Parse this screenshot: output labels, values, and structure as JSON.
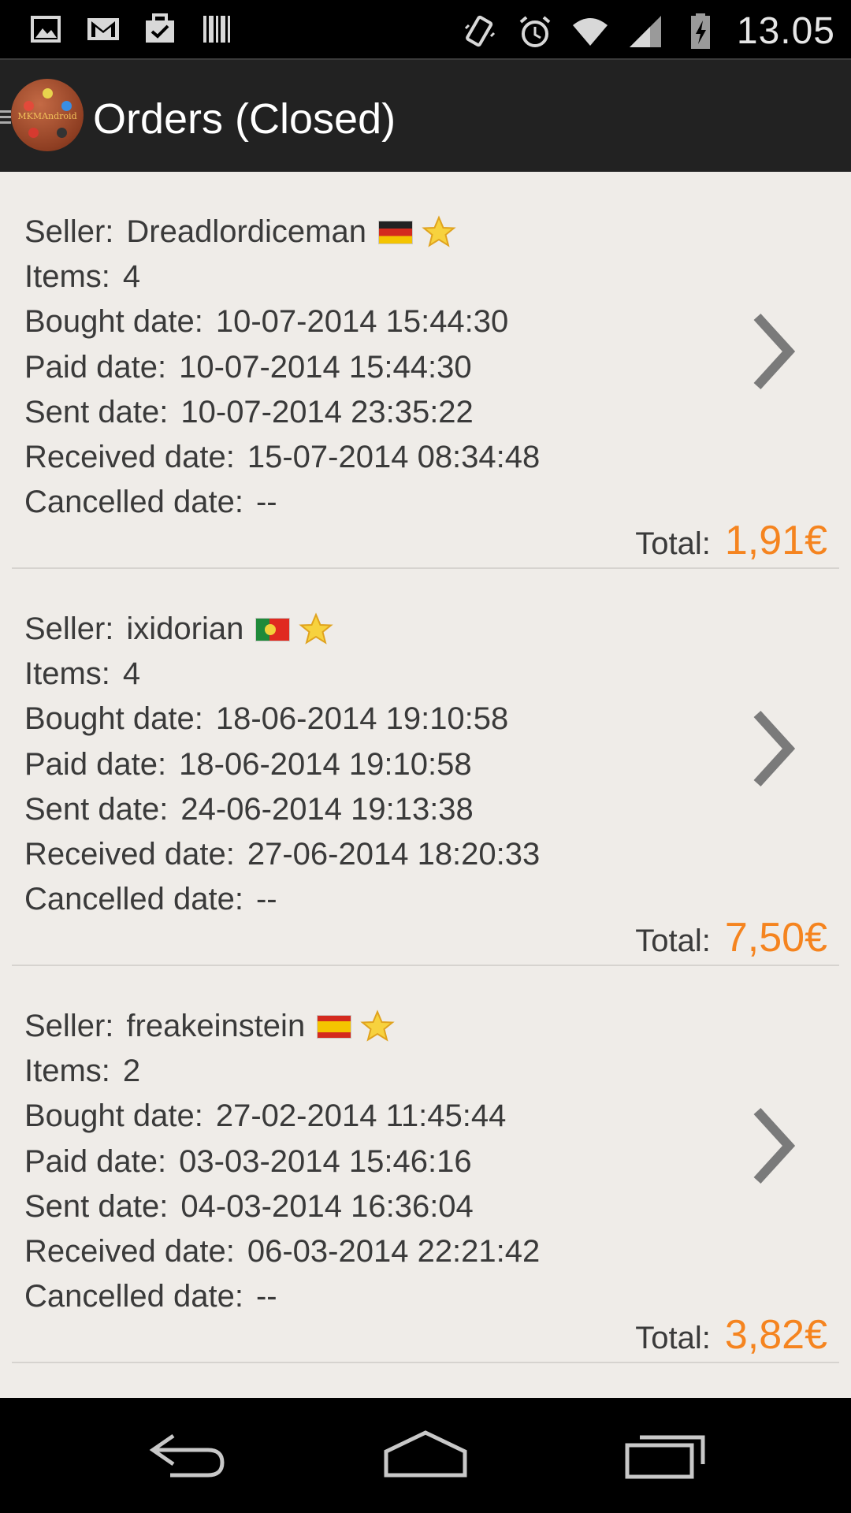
{
  "status_bar": {
    "left_icons": [
      "image-icon",
      "gmail-icon",
      "task-check-icon",
      "barcode-icon"
    ],
    "right_icons": [
      "vibrate-icon",
      "alarm-icon",
      "wifi-icon",
      "signal-icon",
      "battery-charging-icon"
    ],
    "time": "13.05"
  },
  "action_bar": {
    "title": "Orders (Closed)",
    "logo_text": "MKMAndroid"
  },
  "labels": {
    "seller": "Seller:",
    "items": "Items:",
    "bought": "Bought date:",
    "paid": "Paid date:",
    "sent": "Sent date:",
    "received": "Received date:",
    "cancelled": "Cancelled date:",
    "total": "Total:"
  },
  "orders": [
    {
      "seller": "Dreadlordiceman",
      "flag": "flag-germany-icon",
      "items": "4",
      "bought": "10-07-2014 15:44:30",
      "paid": "10-07-2014 15:44:30",
      "sent": "10-07-2014 23:35:22",
      "received": "15-07-2014 08:34:48",
      "cancelled": "--",
      "total": "1,91€"
    },
    {
      "seller": "ixidorian",
      "flag": "flag-portugal-icon",
      "items": "4",
      "bought": "18-06-2014 19:10:58",
      "paid": "18-06-2014 19:10:58",
      "sent": "24-06-2014 19:13:38",
      "received": "27-06-2014 18:20:33",
      "cancelled": "--",
      "total": "7,50€"
    },
    {
      "seller": "freakeinstein",
      "flag": "flag-spain-icon",
      "items": "2",
      "bought": "27-02-2014 11:45:44",
      "paid": "03-03-2014 15:46:16",
      "sent": "04-03-2014 16:36:04",
      "received": "06-03-2014 22:21:42",
      "cancelled": "--",
      "total": "3,82€"
    }
  ],
  "colors": {
    "accent_total": "#f5841f",
    "content_background": "#efece8",
    "action_bar": "#222222"
  },
  "nav_bar": {
    "buttons": [
      "back-icon",
      "home-icon",
      "recent-apps-icon"
    ]
  }
}
